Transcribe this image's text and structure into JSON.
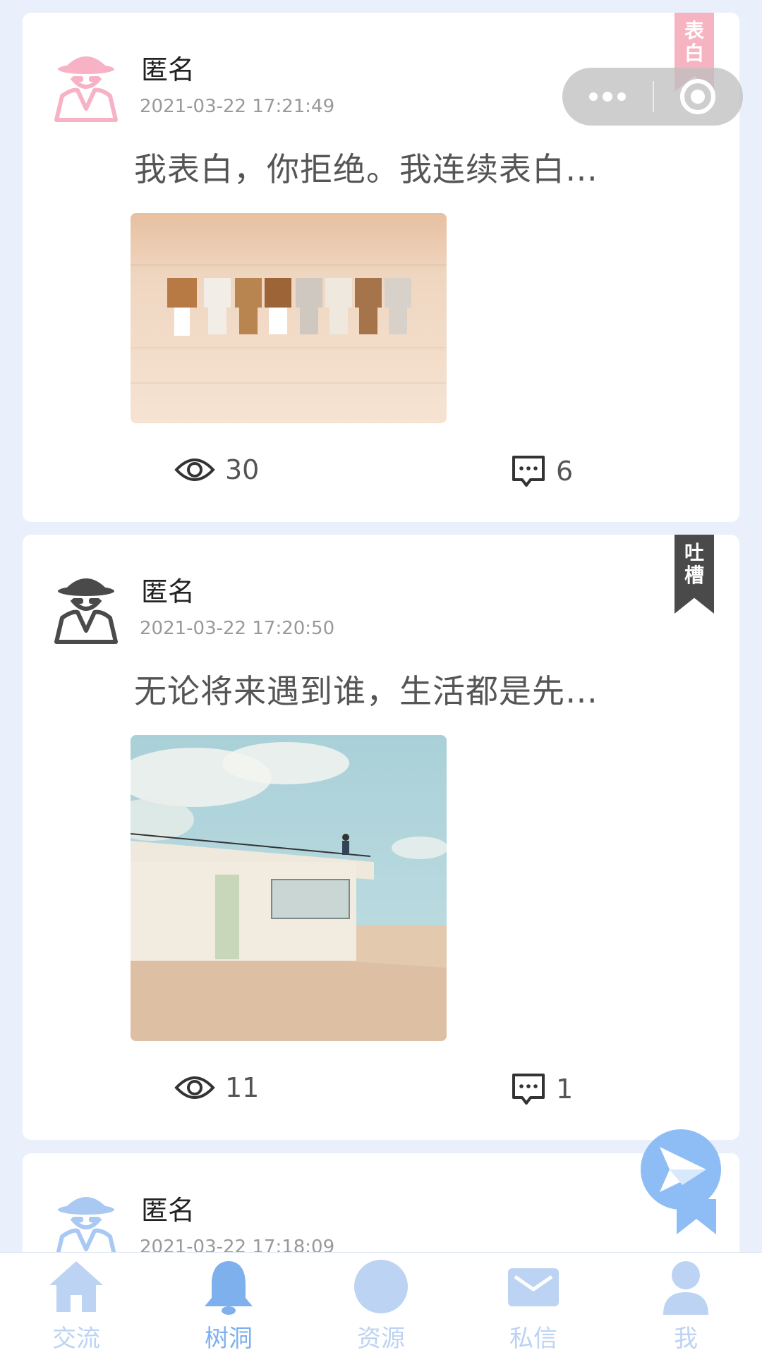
{
  "posts": [
    {
      "name": "匿名",
      "time": "2021-03-22 17:21:49",
      "content": "我表白，你拒绝。我连续表白…",
      "views": "30",
      "comments": "6",
      "tag": [
        "表",
        "白"
      ],
      "avatar_color": "#f7b3c5"
    },
    {
      "name": "匿名",
      "time": "2021-03-22 17:20:50",
      "content": "无论将来遇到谁，生活都是先…",
      "views": "11",
      "comments": "1",
      "tag": [
        "吐",
        "槽"
      ],
      "avatar_color": "#4a4a4a"
    },
    {
      "name": "匿名",
      "time": "2021-03-22 17:18:09",
      "avatar_color": "#a9c9f3"
    }
  ],
  "tabbar": {
    "items": [
      {
        "label": "交流",
        "icon": "home-icon"
      },
      {
        "label": "树洞",
        "icon": "bell-icon",
        "active": true
      },
      {
        "label": "资源",
        "icon": "compass-icon"
      },
      {
        "label": "私信",
        "icon": "mail-icon"
      },
      {
        "label": "我",
        "icon": "user-icon"
      }
    ]
  },
  "colors": {
    "background": "#e9f0fb",
    "accent": "#7fb0ee",
    "tab_inactive": "#bcd3f3",
    "fab": "#8ebdf5"
  }
}
